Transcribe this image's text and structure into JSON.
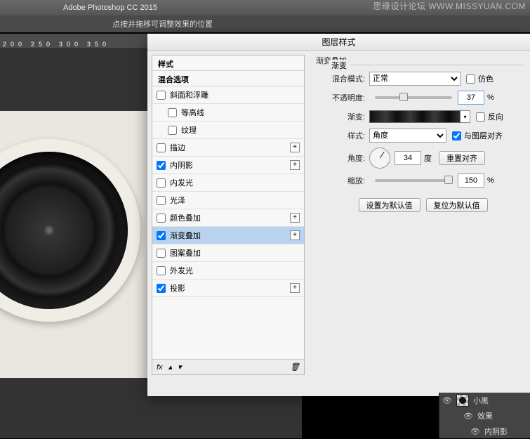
{
  "app": {
    "title": "Adobe Photoshop CC 2015",
    "tool_hint": "点按并拖移可调整效果的位置"
  },
  "watermark": "思缘设计论坛  WWW.MISSYUAN.COM",
  "ruler": [
    "200",
    "250",
    "300",
    "350"
  ],
  "dialog": {
    "title": "图层样式"
  },
  "styles": {
    "header1": "样式",
    "header2": "混合选项",
    "items": [
      {
        "label": "斜面和浮雕",
        "checked": false,
        "has_plus": false
      },
      {
        "label": "等高线",
        "checked": false,
        "sub": true
      },
      {
        "label": "纹理",
        "checked": false,
        "sub": true
      },
      {
        "label": "描边",
        "checked": false,
        "has_plus": true
      },
      {
        "label": "内阴影",
        "checked": true,
        "has_plus": true
      },
      {
        "label": "内发光",
        "checked": false
      },
      {
        "label": "光泽",
        "checked": false
      },
      {
        "label": "颜色叠加",
        "checked": false,
        "has_plus": true
      },
      {
        "label": "渐变叠加",
        "checked": true,
        "has_plus": true,
        "selected": true
      },
      {
        "label": "图案叠加",
        "checked": false
      },
      {
        "label": "外发光",
        "checked": false
      },
      {
        "label": "投影",
        "checked": true,
        "has_plus": true
      }
    ],
    "fx_label": "fx"
  },
  "detail": {
    "section": "渐变叠加",
    "group": "渐变",
    "blend": {
      "label": "混合模式:",
      "value": "正常",
      "dither_label": "仿色",
      "dither": false
    },
    "opacity": {
      "label": "不透明度:",
      "value": "37",
      "unit": "%",
      "pos": 37
    },
    "gradient": {
      "label": "渐变:",
      "reverse_label": "反向",
      "reverse": false
    },
    "style": {
      "label": "样式:",
      "value": "角度",
      "align_label": "与图层对齐",
      "align": true
    },
    "angle": {
      "label": "角度:",
      "value": "34",
      "unit": "度",
      "reset": "重置对齐"
    },
    "scale": {
      "label": "缩放:",
      "value": "150",
      "unit": "%",
      "pos": 95
    },
    "defaults": {
      "set": "设置为默认值",
      "reset": "复位为默认值"
    }
  },
  "layers": {
    "name": "小黑",
    "fx": "效果",
    "sub": "内阴影"
  }
}
